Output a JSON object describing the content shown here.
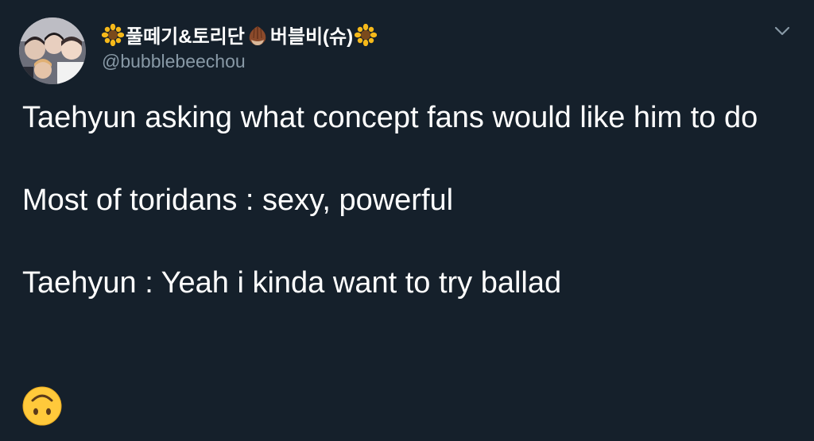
{
  "tweet": {
    "display_name": "풀떼기&토리단",
    "display_name_2": "버블비(슈)",
    "handle": "@bubblebeechou",
    "text_line_1": "Taehyun asking what concept fans would like him to do",
    "text_line_2": "Most of toridans : sexy, powerful",
    "text_line_3": "Taehyun : Yeah i kinda want to try ballad",
    "emojis": [
      "sunflower-emoji",
      "chestnut-emoji",
      "sunflower-emoji",
      "upside-down-face-emoji"
    ]
  },
  "colors": {
    "background": "#15202b",
    "text": "#ffffff",
    "secondary_text": "#8899a6"
  }
}
